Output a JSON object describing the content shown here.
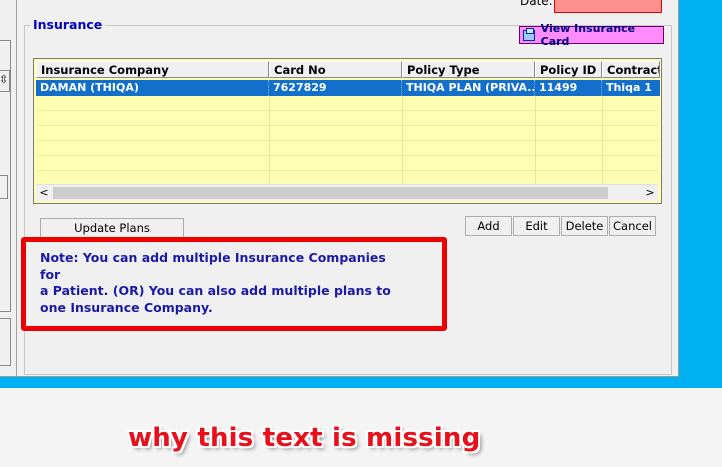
{
  "insurance": {
    "legend": "Insurance",
    "date_label": "Date:",
    "view_card_label": "View Insurance Card",
    "columns": [
      "Insurance Company",
      "Card No",
      "Policy Type",
      "Policy ID",
      "Contract"
    ],
    "rows": [
      {
        "company": "DAMAN (THIQA)",
        "card_no": "7627829",
        "policy_type": "THIQA PLAN (PRIVA...",
        "policy_id": "11499",
        "contract": "Thiqa 1"
      }
    ],
    "buttons": {
      "update_plans": "Update Plans",
      "add": "Add",
      "edit": "Edit",
      "delete": "Delete",
      "cancel": "Cancel"
    },
    "note": "Note: You can add multiple Insurance Companies for\na Patient.  (OR)  You can also add multiple plans to\none Insurance Company."
  },
  "caption": "why this text is missing",
  "colors": {
    "background_blue": "#00b0f0",
    "selection": "#1270cc",
    "grid_fill": "#ffffb4",
    "note_text": "#1a1aa8",
    "highlight_red": "#ee0000",
    "view_button": "#ff8cff"
  }
}
